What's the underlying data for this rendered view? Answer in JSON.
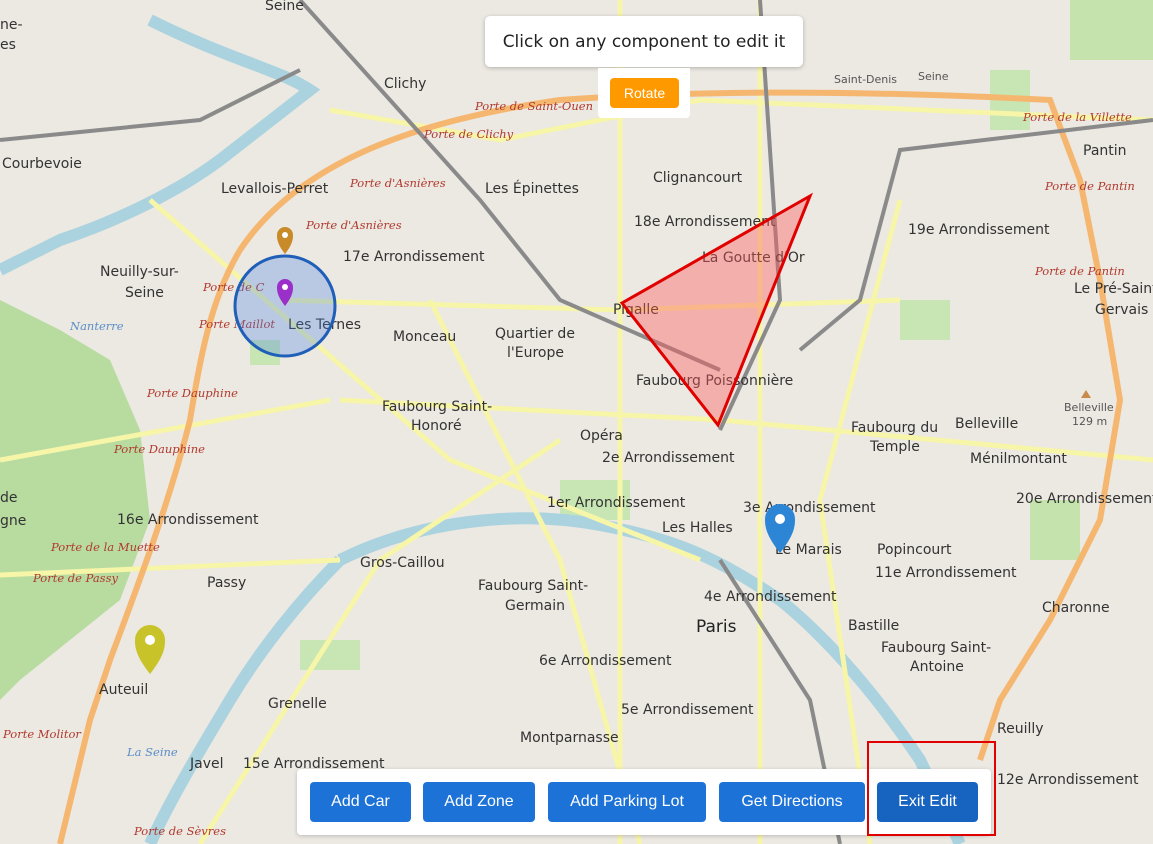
{
  "tooltip": {
    "text": "Click on any component to edit it"
  },
  "rotate_label": "Rotate",
  "toolbar": {
    "add_car": "Add Car",
    "add_zone": "Add Zone",
    "add_parking_lot": "Add Parking Lot",
    "get_directions": "Get Directions",
    "exit_edit": "Exit Edit"
  },
  "map": {
    "neighborhoods": [
      "Seine",
      "Clichy",
      "Courbevoie",
      "Levallois-Perret",
      "Les Épinettes",
      "Clignancourt",
      "Saint-Denis",
      "Pantin",
      "18e Arrondissement",
      "19e Arrondissement",
      "La Goutte d'Or",
      "17e Arrondissement",
      "Neuilly-sur-",
      "Seine",
      "Les Ternes",
      "Monceau",
      "Quartier de",
      "l'Europe",
      "Pigalle",
      "Faubourg Poissonnière",
      "Le Pré-Saint-",
      "Gervais",
      "Faubourg Saint-",
      "Honoré",
      "Opéra",
      "2e Arrondissement",
      "Faubourg du",
      "Temple",
      "Belleville",
      "Ménilmontant",
      "1er Arrondissement",
      "Les Halles",
      "3e Arrondissement",
      "Le Marais",
      "Popincourt",
      "11e Arrondissement",
      "20e Arrondissement",
      "16e Arrondissement",
      "Gros-Caillou",
      "Faubourg Saint-",
      "Germain",
      "4e Arrondissement",
      "Charonne",
      "Passy",
      "Paris",
      "Bastille",
      "Faubourg Saint-",
      "Antoine",
      "6e Arrondissement",
      "Auteuil",
      "Grenelle",
      "5e Arrondissement",
      "Reuilly",
      "Montparnasse",
      "Javel",
      "15e Arrondissement",
      "12e Arrondissement"
    ],
    "gates": [
      "Porte de Saint-Ouen",
      "Porte de Clichy",
      "Porte d'Asnières",
      "Porte d'Asnières",
      "Porte de la Villette",
      "Porte de Pantin",
      "Porte de Pantin",
      "Porte de C",
      "Porte Maillot",
      "Porte Dauphine",
      "Porte Dauphine",
      "Porte de la Muette",
      "Porte de Passy",
      "Porte Molitor",
      "Porte de Sèvres"
    ],
    "water": [
      "La Seine",
      "La Seine",
      "Nanterre"
    ],
    "elevation": {
      "name": "Belleville",
      "value": "129 m"
    },
    "fragments": [
      "ne-",
      "es",
      "de",
      "gne",
      "Seine",
      "Saint-Denis"
    ]
  }
}
